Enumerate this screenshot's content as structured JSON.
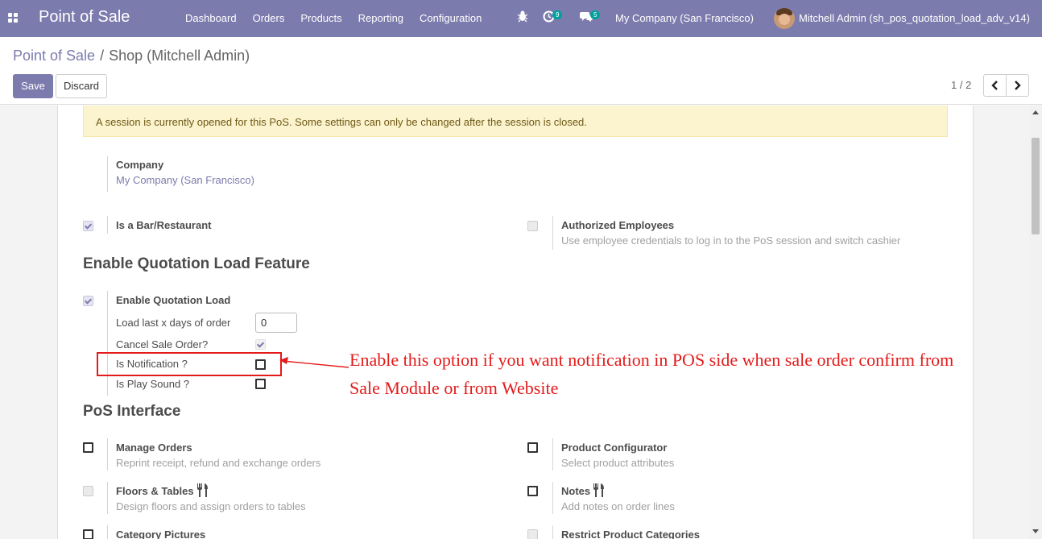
{
  "navbar": {
    "brand": "Point of Sale",
    "menu": [
      "Dashboard",
      "Orders",
      "Products",
      "Reporting",
      "Configuration"
    ],
    "activity_count": "9",
    "messages_count": "5",
    "company": "My Company (San Francisco)",
    "user": "Mitchell Admin (sh_pos_quotation_load_adv_v14)"
  },
  "breadcrumb": {
    "parent": "Point of Sale",
    "separator": "/",
    "current": "Shop (Mitchell Admin)"
  },
  "actions": {
    "save": "Save",
    "discard": "Discard"
  },
  "pager": {
    "value": "1 / 2"
  },
  "alert": "A session is currently opened for this PoS. Some settings can only be changed after the session is closed.",
  "company_field": {
    "label": "Company",
    "value": "My Company (San Francisco)"
  },
  "bar_restaurant": {
    "label": "Is a Bar/Restaurant",
    "checked": true
  },
  "authorized_employees": {
    "label": "Authorized Employees",
    "help": "Use employee credentials to log in to the PoS session and switch cashier",
    "checked": false
  },
  "quotation_section": {
    "title": "Enable Quotation Load Feature",
    "enable_label": "Enable Quotation Load",
    "load_days_label": "Load last x days of order",
    "load_days_value": "0",
    "cancel_label": "Cancel Sale Order?",
    "notification_label": "Is Notification ?",
    "play_sound_label": "Is Play Sound ?"
  },
  "annotation": {
    "text": "Enable this option if you want notification in POS side when sale order confirm from Sale Module or from Website",
    "color": "#e31b1b"
  },
  "pos_interface": {
    "title": "PoS Interface",
    "items": [
      {
        "label": "Manage Orders",
        "help": "Reprint receipt, refund and exchange orders"
      },
      {
        "label": "Product Configurator",
        "help": "Select product attributes"
      },
      {
        "label": "Floors & Tables",
        "help": "Design floors and assign orders to tables"
      },
      {
        "label": "Notes",
        "help": "Add notes on order lines"
      },
      {
        "label": "Category Pictures",
        "help": ""
      },
      {
        "label": "Restrict Product Categories",
        "help": ""
      }
    ]
  },
  "colors": {
    "brand": "#7c7bad",
    "alert_bg": "#fcf3cf",
    "badge": "#00a09d"
  }
}
